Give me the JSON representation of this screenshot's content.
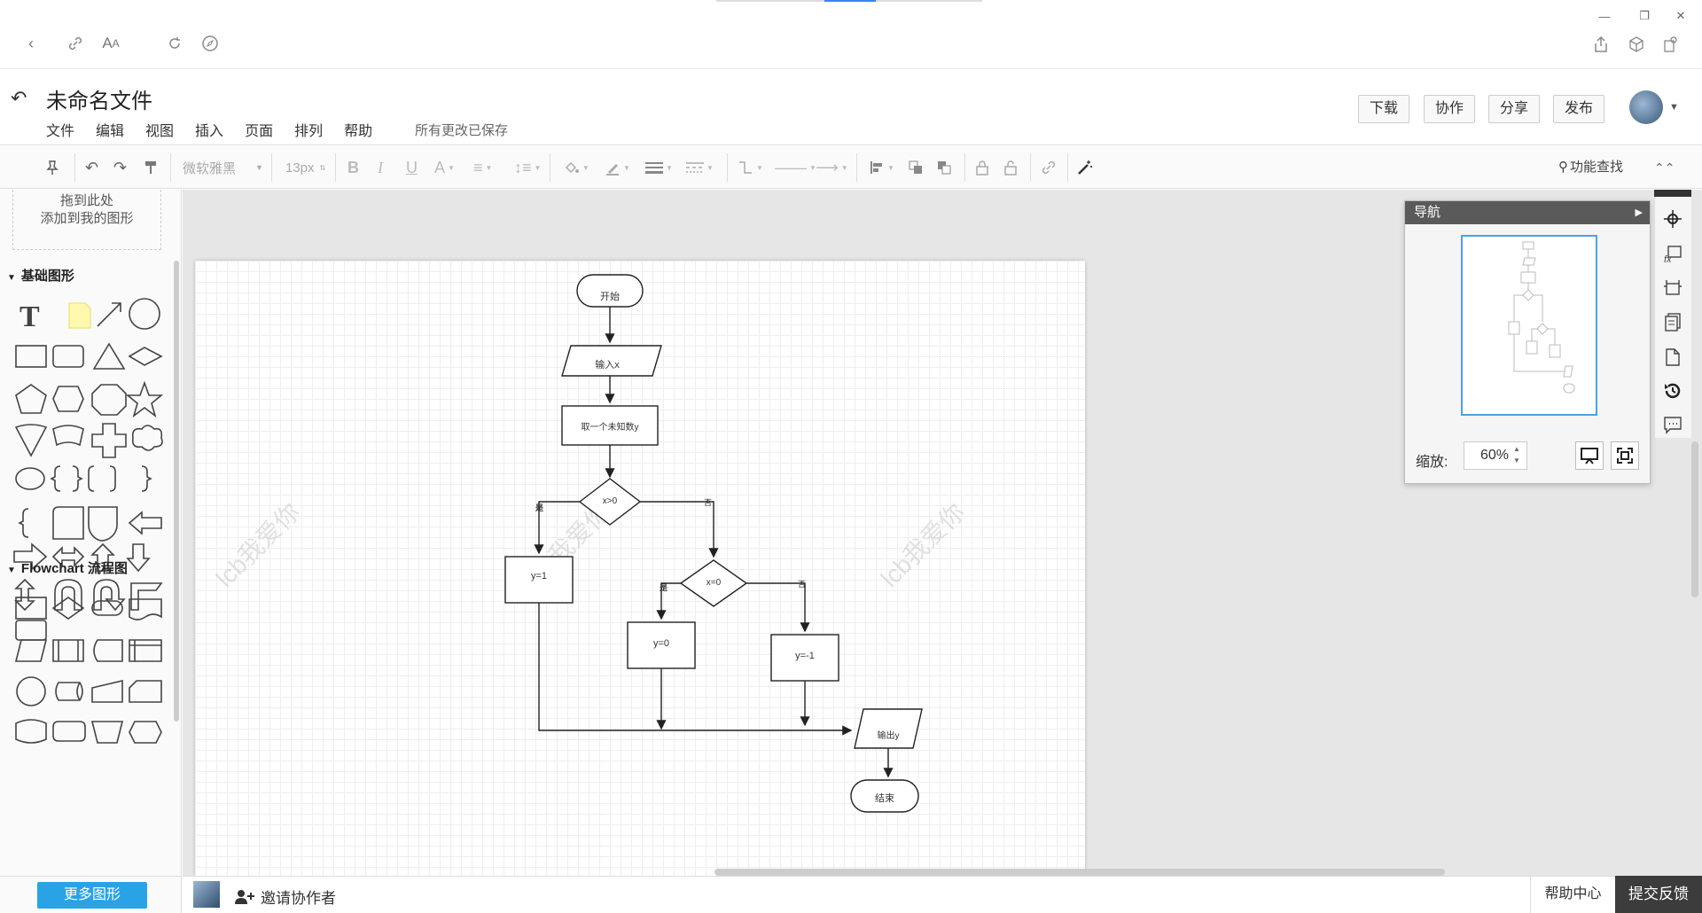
{
  "app": {
    "doc_title": "未命名文件",
    "save_status": "所有更改已保存"
  },
  "menu": [
    "文件",
    "编辑",
    "视图",
    "插入",
    "页面",
    "排列",
    "帮助"
  ],
  "header_buttons": {
    "download": "下载",
    "collaborate": "协作",
    "share": "分享",
    "publish": "发布"
  },
  "toolbar": {
    "font_family": "微软雅黑",
    "font_size": "13px",
    "search_label": "功能查找"
  },
  "left_panel": {
    "drop_zone_line1": "拖到此处",
    "drop_zone_line2": "添加到我的图形",
    "section_basic": "基础图形",
    "section_flowchart": "Flowchart 流程图",
    "more_shapes": "更多图形"
  },
  "diagram": {
    "start": "开始",
    "input": "输入x",
    "take": "取一个未知数y",
    "cond1": "x>0",
    "cond2": "x=0",
    "yes1": "是",
    "no1": "否",
    "yes2": "是",
    "no2": "否",
    "y1": "y=1",
    "y0": "y=0",
    "yneg": "y=-1",
    "output": "输出y",
    "end": "结束",
    "watermark": "lcb我爱你"
  },
  "navigator": {
    "title": "导航",
    "zoom_label": "缩放:",
    "zoom_value": "60%"
  },
  "bottom": {
    "invite": "邀请协作者",
    "help_center": "帮助中心",
    "feedback": "提交反馈"
  },
  "colors": {
    "accent": "#29a3e6",
    "nav_header": "#5a5a5a",
    "feedback_bg": "#3c3c3c"
  }
}
